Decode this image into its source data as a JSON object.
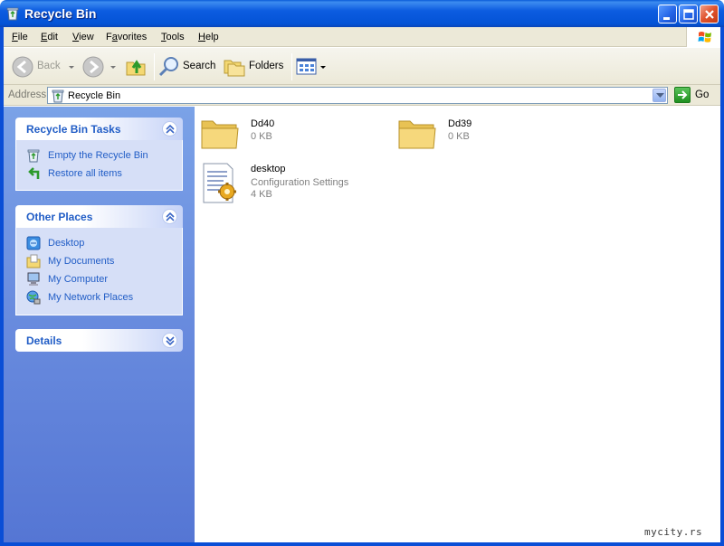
{
  "window": {
    "title": "Recycle Bin",
    "icon": "recycle-bin-icon"
  },
  "menu": {
    "items": [
      {
        "label": "File",
        "accel": "F",
        "rest": "ile"
      },
      {
        "label": "Edit",
        "accel": "E",
        "rest": "dit"
      },
      {
        "label": "View",
        "accel": "V",
        "rest": "iew"
      },
      {
        "label": "Favorites",
        "accel": "a",
        "pre": "F",
        "rest": "vorites"
      },
      {
        "label": "Tools",
        "accel": "T",
        "rest": "ools"
      },
      {
        "label": "Help",
        "accel": "H",
        "rest": "elp"
      }
    ]
  },
  "toolbar": {
    "back_label": "Back",
    "search_label": "Search",
    "folders_label": "Folders"
  },
  "address": {
    "label": "Address",
    "value": "Recycle Bin",
    "go_label": "Go"
  },
  "taskpane": {
    "recycle_tasks": {
      "title": "Recycle Bin Tasks",
      "items": [
        {
          "label": "Empty the Recycle Bin",
          "icon": "empty-recycle-bin-icon"
        },
        {
          "label": "Restore all items",
          "icon": "restore-icon"
        }
      ]
    },
    "other_places": {
      "title": "Other Places",
      "items": [
        {
          "label": "Desktop",
          "icon": "desktop-icon"
        },
        {
          "label": "My Documents",
          "icon": "my-documents-icon"
        },
        {
          "label": "My Computer",
          "icon": "my-computer-icon"
        },
        {
          "label": "My Network Places",
          "icon": "network-places-icon"
        }
      ]
    },
    "details": {
      "title": "Details"
    }
  },
  "files": [
    {
      "name": "Dd40",
      "line2": "0 KB",
      "icon": "folder-icon"
    },
    {
      "name": "Dd39",
      "line2": "0 KB",
      "icon": "folder-icon"
    },
    {
      "name": "desktop",
      "line2": "Configuration Settings",
      "line3": "4 KB",
      "icon": "config-settings-icon"
    }
  ],
  "watermark": "mycity.rs",
  "colors": {
    "titlebar": "#0453d6",
    "taskpane": "#6c8fe0",
    "task_link": "#215dc6"
  }
}
